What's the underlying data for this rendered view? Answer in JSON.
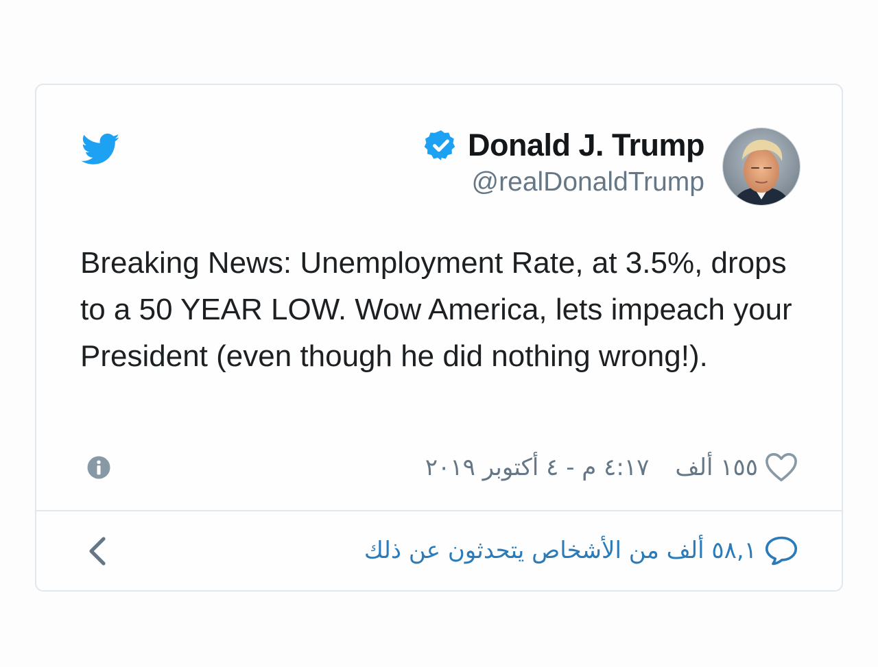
{
  "author": {
    "display_name": "Donald J. Trump",
    "handle": "@realDonaldTrump"
  },
  "tweet": {
    "text": "Breaking News: Unemployment Rate, at 3.5%, drops to a 50 YEAR LOW. Wow America, lets impeach your President (even though he did nothing wrong!)."
  },
  "meta": {
    "likes": "١٥٥ ألف",
    "timestamp": "٤:١٧ م - ٤ أكتوبر ٢٠١٩"
  },
  "footer": {
    "conversation": "٥٨,١ ألف من الأشخاص يتحدثون عن ذلك"
  },
  "icons": {
    "logo": "twitter-bird-icon",
    "verified": "verified-badge-icon",
    "info": "info-icon",
    "like": "heart-icon",
    "reply": "speech-bubble-icon",
    "back": "chevron-left-icon"
  },
  "colors": {
    "brand": "#1da1f2",
    "text": "#14171a",
    "secondary": "#657786",
    "link": "#2b7bb9",
    "border": "#e1e8ed"
  }
}
